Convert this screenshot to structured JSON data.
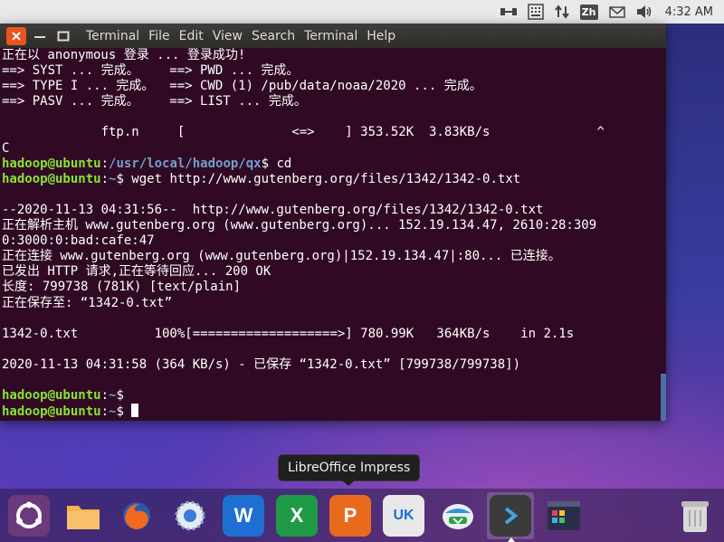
{
  "top_panel": {
    "icons": [
      "network-icon",
      "keyboard-icon",
      "transfer-icon",
      "mail-icon",
      "volume-icon"
    ],
    "language": "Zh",
    "clock": "4:32 AM"
  },
  "terminal": {
    "menu": [
      "Terminal",
      "File",
      "Edit",
      "View",
      "Search",
      "Terminal",
      "Help"
    ],
    "lines": [
      [
        {
          "t": "正在以 anonymous 登录 ... 登录成功!",
          "c": ""
        }
      ],
      [
        {
          "t": "==> SYST ... 完成。    ==> PWD ... 完成。",
          "c": ""
        }
      ],
      [
        {
          "t": "==> TYPE I ... 完成。  ==> CWD (1) /pub/data/noaa/2020 ... 完成。",
          "c": ""
        }
      ],
      [
        {
          "t": "==> PASV ... 完成。    ==> LIST ... 完成。",
          "c": ""
        }
      ],
      [
        {
          "t": "",
          "c": ""
        }
      ],
      [
        {
          "t": "             ftp.n     [              <=>    ] 353.52K  3.83KB/s              ^",
          "c": ""
        }
      ],
      [
        {
          "t": "C",
          "c": ""
        }
      ],
      [
        {
          "t": "hadoop@ubuntu",
          "c": "user"
        },
        {
          "t": ":",
          "c": ""
        },
        {
          "t": "/usr/local/hadoop/qx",
          "c": "path"
        },
        {
          "t": "$ cd",
          "c": ""
        }
      ],
      [
        {
          "t": "hadoop@ubuntu",
          "c": "user"
        },
        {
          "t": ":",
          "c": ""
        },
        {
          "t": "~",
          "c": "path"
        },
        {
          "t": "$ wget http://www.gutenberg.org/files/1342/1342-0.txt",
          "c": ""
        }
      ],
      [
        {
          "t": "",
          "c": ""
        }
      ],
      [
        {
          "t": "--2020-11-13 04:31:56--  http://www.gutenberg.org/files/1342/1342-0.txt",
          "c": ""
        }
      ],
      [
        {
          "t": "正在解析主机 www.gutenberg.org (www.gutenberg.org)... 152.19.134.47, 2610:28:309",
          "c": ""
        }
      ],
      [
        {
          "t": "0:3000:0:bad:cafe:47",
          "c": ""
        }
      ],
      [
        {
          "t": "正在连接 www.gutenberg.org (www.gutenberg.org)|152.19.134.47|:80... 已连接。",
          "c": ""
        }
      ],
      [
        {
          "t": "已发出 HTTP 请求,正在等待回应... 200 OK",
          "c": ""
        }
      ],
      [
        {
          "t": "长度: 799738 (781K) [text/plain]",
          "c": ""
        }
      ],
      [
        {
          "t": "正在保存至: “1342-0.txt”",
          "c": ""
        }
      ],
      [
        {
          "t": "",
          "c": ""
        }
      ],
      [
        {
          "t": "1342-0.txt          100%[===================>] 780.99K   364KB/s    in 2.1s",
          "c": ""
        }
      ],
      [
        {
          "t": "",
          "c": ""
        }
      ],
      [
        {
          "t": "2020-11-13 04:31:58 (364 KB/s) - 已保存 “1342-0.txt” [799738/799738])",
          "c": ""
        }
      ],
      [
        {
          "t": "",
          "c": ""
        }
      ],
      [
        {
          "t": "hadoop@ubuntu",
          "c": "user"
        },
        {
          "t": ":",
          "c": ""
        },
        {
          "t": "~",
          "c": "path"
        },
        {
          "t": "$",
          "c": ""
        }
      ],
      [
        {
          "t": "hadoop@ubuntu",
          "c": "user"
        },
        {
          "t": ":",
          "c": ""
        },
        {
          "t": "~",
          "c": "path"
        },
        {
          "t": "$ ",
          "c": ""
        },
        {
          "t": "",
          "c": "cursor"
        }
      ]
    ]
  },
  "tooltip": {
    "text": "LibreOffice Impress"
  },
  "dock": {
    "items": [
      {
        "name": "ubuntu-dash-icon",
        "color": "#6a3a7c"
      },
      {
        "name": "files-folder-icon",
        "color": "#f4a23a"
      },
      {
        "name": "firefox-icon",
        "color": "#e8582a"
      },
      {
        "name": "chromium-browser-icon",
        "color": "#4a7fc8"
      },
      {
        "name": "libreoffice-writer-icon",
        "color": "#1e6fd2",
        "letter": "W"
      },
      {
        "name": "libreoffice-calc-icon",
        "color": "#1f9a47",
        "letter": "X"
      },
      {
        "name": "libreoffice-impress-icon",
        "color": "#e86a1c",
        "letter": "P"
      },
      {
        "name": "software-center-icon",
        "color": "#e8e8e8",
        "letter": "UK"
      },
      {
        "name": "system-updater-icon",
        "color": "#3c8de0"
      },
      {
        "name": "terminal-icon",
        "color": "#3b3b3b"
      },
      {
        "name": "workspace-switcher-icon",
        "color": "#3fa6d8"
      },
      {
        "name": "trash-icon",
        "color": "#cfcfcf"
      }
    ]
  }
}
